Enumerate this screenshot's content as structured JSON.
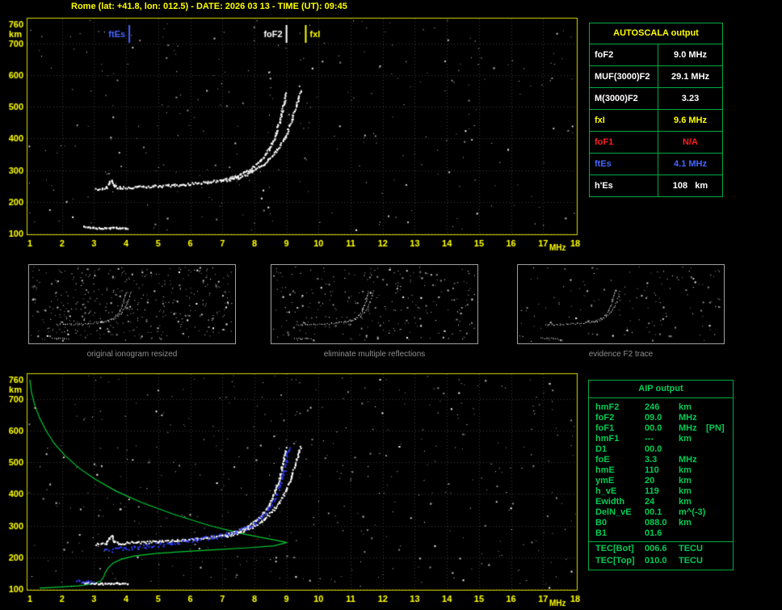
{
  "title": "Rome (lat: +41.8, lon: 012.5) - DATE: 2026 03 13 - TIME (UT): 09:45",
  "colors": {
    "accent_yellow": "#ffff00",
    "panel_border": "#d8d800",
    "grid": "#3d3d3d",
    "table_border_green": "#00aa44",
    "text_green": "#00cc55",
    "blue": "#4666ff",
    "red": "#ff2020",
    "white": "#ffffff",
    "caption_gray": "#8f8f8f",
    "profile_green": "#00cc33",
    "restored_blue": "#2e3dff"
  },
  "autoscala": {
    "title": "AUTOSCALA output",
    "rows": [
      {
        "label": "foF2",
        "value": "9.0 MHz",
        "color": "#ffffff"
      },
      {
        "label": "MUF(3000)F2",
        "value": "29.1 MHz",
        "color": "#ffffff"
      },
      {
        "label": "M(3000)F2",
        "value": "3.23",
        "color": "#ffffff"
      },
      {
        "label": "fxI",
        "value": "9.6 MHz",
        "color": "#ffff00"
      },
      {
        "label": "foF1",
        "value": "N/A",
        "color": "#ff2020"
      },
      {
        "label": "ftEs",
        "value": "4.1 MHz",
        "color": "#4666ff"
      },
      {
        "label": "h'Es",
        "value": "108   km",
        "color": "#ffffff"
      }
    ]
  },
  "aip": {
    "title": "AIP output",
    "rows": [
      {
        "name": "hmF2",
        "value": "246",
        "unit": "km"
      },
      {
        "name": "foF2",
        "value": "09.0",
        "unit": "MHz"
      },
      {
        "name": "foF1",
        "value": "00.0",
        "unit": "MHz",
        "note": "[PN]"
      },
      {
        "name": "hmF1",
        "value": "---",
        "unit": "km"
      },
      {
        "name": "D1",
        "value": "00.0",
        "unit": ""
      },
      {
        "name": "foE",
        "value": "3.3",
        "unit": "MHz"
      },
      {
        "name": "hmE",
        "value": "110",
        "unit": "km"
      },
      {
        "name": "ymE",
        "value": "20",
        "unit": "km"
      },
      {
        "name": "h_vE",
        "value": "119",
        "unit": "km"
      },
      {
        "name": "Ewidth",
        "value": "24",
        "unit": "km"
      },
      {
        "name": "DelN_vE",
        "value": "00.1",
        "unit": "m^(-3)"
      },
      {
        "name": "B0",
        "value": "088.0",
        "unit": "km"
      },
      {
        "name": "B1",
        "value": "01.6",
        "unit": ""
      },
      {
        "name": "TEC[Bot]",
        "value": "006.6",
        "unit": "TECU"
      },
      {
        "name": "TEC[Top]",
        "value": "010.0",
        "unit": "TECU"
      }
    ]
  },
  "thumbnails": [
    {
      "caption": "original ionogram resized",
      "noise_count": 430
    },
    {
      "caption": "eliminate multiple reflections",
      "noise_count": 270
    },
    {
      "caption": "evidence F2 trace",
      "noise_count": 150
    }
  ],
  "chart_data": [
    {
      "id": "top_ionogram",
      "type": "scatter",
      "title": "",
      "xlabel": "MHz",
      "ylabel": "km",
      "xlim": [
        1,
        18
      ],
      "ylim": [
        100,
        760
      ],
      "xticks": [
        1,
        2,
        3,
        4,
        5,
        6,
        7,
        8,
        9,
        10,
        11,
        12,
        13,
        14,
        15,
        16,
        17,
        18
      ],
      "yticks": [
        760,
        700,
        600,
        500,
        400,
        300,
        200,
        100
      ],
      "grid": true,
      "seed": 11,
      "markers": [
        {
          "label": "ftEs",
          "freq": 4.1,
          "color": "#4666ff",
          "side": "left"
        },
        {
          "label": "foF2",
          "freq": 9.0,
          "color": "#ffffff",
          "side": "left"
        },
        {
          "label": "fxI",
          "freq": 9.6,
          "color": "#ffff00",
          "side": "right"
        }
      ],
      "traces": [
        {
          "name": "F2-ordinary",
          "color": "#ffffff",
          "size": 2,
          "spacing": 1.6,
          "jx": 2,
          "jy": 3,
          "points": [
            [
              3.05,
              243
            ],
            [
              3.35,
              245
            ],
            [
              3.45,
              262
            ],
            [
              3.55,
              268
            ],
            [
              3.62,
              250
            ],
            [
              3.8,
              246
            ],
            [
              4.3,
              248
            ],
            [
              5.0,
              251
            ],
            [
              5.8,
              256
            ],
            [
              6.5,
              263
            ],
            [
              7.0,
              271
            ],
            [
              7.4,
              282
            ],
            [
              7.8,
              300
            ],
            [
              8.15,
              328
            ],
            [
              8.45,
              368
            ],
            [
              8.65,
              415
            ],
            [
              8.8,
              465
            ],
            [
              8.9,
              512
            ],
            [
              8.97,
              545
            ]
          ]
        },
        {
          "name": "F2-extraordinary",
          "color": "#ffffff",
          "size": 2,
          "spacing": 1.8,
          "jx": 2,
          "jy": 3,
          "points": [
            [
              7.1,
              268
            ],
            [
              7.5,
              278
            ],
            [
              7.9,
              295
            ],
            [
              8.3,
              322
            ],
            [
              8.65,
              360
            ],
            [
              8.95,
              408
            ],
            [
              9.15,
              458
            ],
            [
              9.3,
              508
            ],
            [
              9.42,
              550
            ]
          ]
        },
        {
          "name": "Es-layer",
          "color": "#ffffff",
          "size": 2,
          "spacing": 1.5,
          "jx": 2,
          "jy": 2,
          "points": [
            [
              2.65,
              122
            ],
            [
              3.2,
              118
            ],
            [
              3.7,
              120
            ],
            [
              4.05,
              118
            ]
          ]
        }
      ],
      "noise": {
        "count": 300,
        "seed": 5
      }
    },
    {
      "id": "bottom_ionogram",
      "type": "scatter",
      "title": "",
      "xlabel": "MHz",
      "ylabel": "km",
      "xlim": [
        1,
        18
      ],
      "ylim": [
        100,
        760
      ],
      "xticks": [
        1,
        2,
        3,
        4,
        5,
        6,
        7,
        8,
        9,
        10,
        11,
        12,
        13,
        14,
        15,
        16,
        17,
        18
      ],
      "yticks": [
        760,
        700,
        600,
        500,
        400,
        300,
        200,
        100
      ],
      "grid": true,
      "seed": 29,
      "traces": [
        {
          "name": "F2-ordinary",
          "color": "#ffffff",
          "size": 2,
          "spacing": 1.6,
          "jx": 2,
          "jy": 3,
          "points": [
            [
              3.05,
              243
            ],
            [
              3.35,
              245
            ],
            [
              3.45,
              262
            ],
            [
              3.55,
              268
            ],
            [
              3.62,
              250
            ],
            [
              3.8,
              246
            ],
            [
              4.3,
              248
            ],
            [
              5.0,
              251
            ],
            [
              5.8,
              256
            ],
            [
              6.5,
              263
            ],
            [
              7.0,
              271
            ],
            [
              7.4,
              282
            ],
            [
              7.8,
              300
            ],
            [
              8.15,
              328
            ],
            [
              8.45,
              368
            ],
            [
              8.65,
              415
            ],
            [
              8.8,
              465
            ],
            [
              8.9,
              512
            ],
            [
              8.97,
              545
            ]
          ]
        },
        {
          "name": "F2-extraordinary",
          "color": "#ffffff",
          "size": 2,
          "spacing": 1.8,
          "jx": 2,
          "jy": 3,
          "points": [
            [
              7.1,
              268
            ],
            [
              7.5,
              278
            ],
            [
              7.9,
              295
            ],
            [
              8.3,
              322
            ],
            [
              8.65,
              360
            ],
            [
              8.95,
              408
            ],
            [
              9.15,
              458
            ],
            [
              9.3,
              508
            ],
            [
              9.42,
              550
            ]
          ]
        },
        {
          "name": "Es-layer",
          "color": "#ffffff",
          "size": 2,
          "spacing": 1.5,
          "jx": 2,
          "jy": 2,
          "points": [
            [
              2.65,
              122
            ],
            [
              3.2,
              118
            ],
            [
              3.7,
              120
            ],
            [
              4.05,
              118
            ]
          ]
        },
        {
          "name": "restored-F2-trace",
          "color": "#2e3dff",
          "size": 2,
          "spacing": 2.2,
          "jx": 3,
          "jy": 5,
          "points": [
            [
              3.3,
              222
            ],
            [
              3.9,
              229
            ],
            [
              4.6,
              237
            ],
            [
              5.4,
              246
            ],
            [
              6.1,
              256
            ],
            [
              6.8,
              267
            ],
            [
              7.4,
              281
            ],
            [
              7.9,
              302
            ],
            [
              8.25,
              332
            ],
            [
              8.55,
              372
            ],
            [
              8.75,
              418
            ],
            [
              8.9,
              468
            ],
            [
              9.0,
              520
            ],
            [
              9.05,
              548
            ]
          ]
        },
        {
          "name": "restored-Es-trace",
          "color": "#2e3dff",
          "size": 2,
          "spacing": 2.0,
          "jx": 2,
          "jy": 3,
          "points": [
            [
              2.45,
              126
            ],
            [
              2.95,
              122
            ]
          ]
        }
      ],
      "profile": {
        "name": "electron-density-profile",
        "color": "#00cc33",
        "points": [
          [
            1.0,
            760
          ],
          [
            1.05,
            720
          ],
          [
            1.15,
            680
          ],
          [
            1.3,
            640
          ],
          [
            1.5,
            600
          ],
          [
            1.75,
            560
          ],
          [
            2.1,
            520
          ],
          [
            2.55,
            480
          ],
          [
            3.05,
            445
          ],
          [
            3.7,
            408
          ],
          [
            4.5,
            372
          ],
          [
            5.5,
            335
          ],
          [
            6.6,
            300
          ],
          [
            7.6,
            275
          ],
          [
            8.5,
            257
          ],
          [
            8.95,
            248
          ],
          [
            9.0,
            246
          ],
          [
            8.6,
            236
          ],
          [
            7.8,
            230
          ],
          [
            6.8,
            224
          ],
          [
            5.8,
            218
          ],
          [
            4.9,
            212
          ],
          [
            4.25,
            204
          ],
          [
            3.85,
            194
          ],
          [
            3.6,
            182
          ],
          [
            3.45,
            168
          ],
          [
            3.35,
            152
          ],
          [
            3.3,
            138
          ],
          [
            3.2,
            124
          ],
          [
            2.95,
            116
          ],
          [
            2.5,
            110
          ],
          [
            1.9,
            106
          ],
          [
            1.3,
            103
          ]
        ]
      },
      "noise": {
        "count": 430,
        "seed": 9
      }
    }
  ]
}
